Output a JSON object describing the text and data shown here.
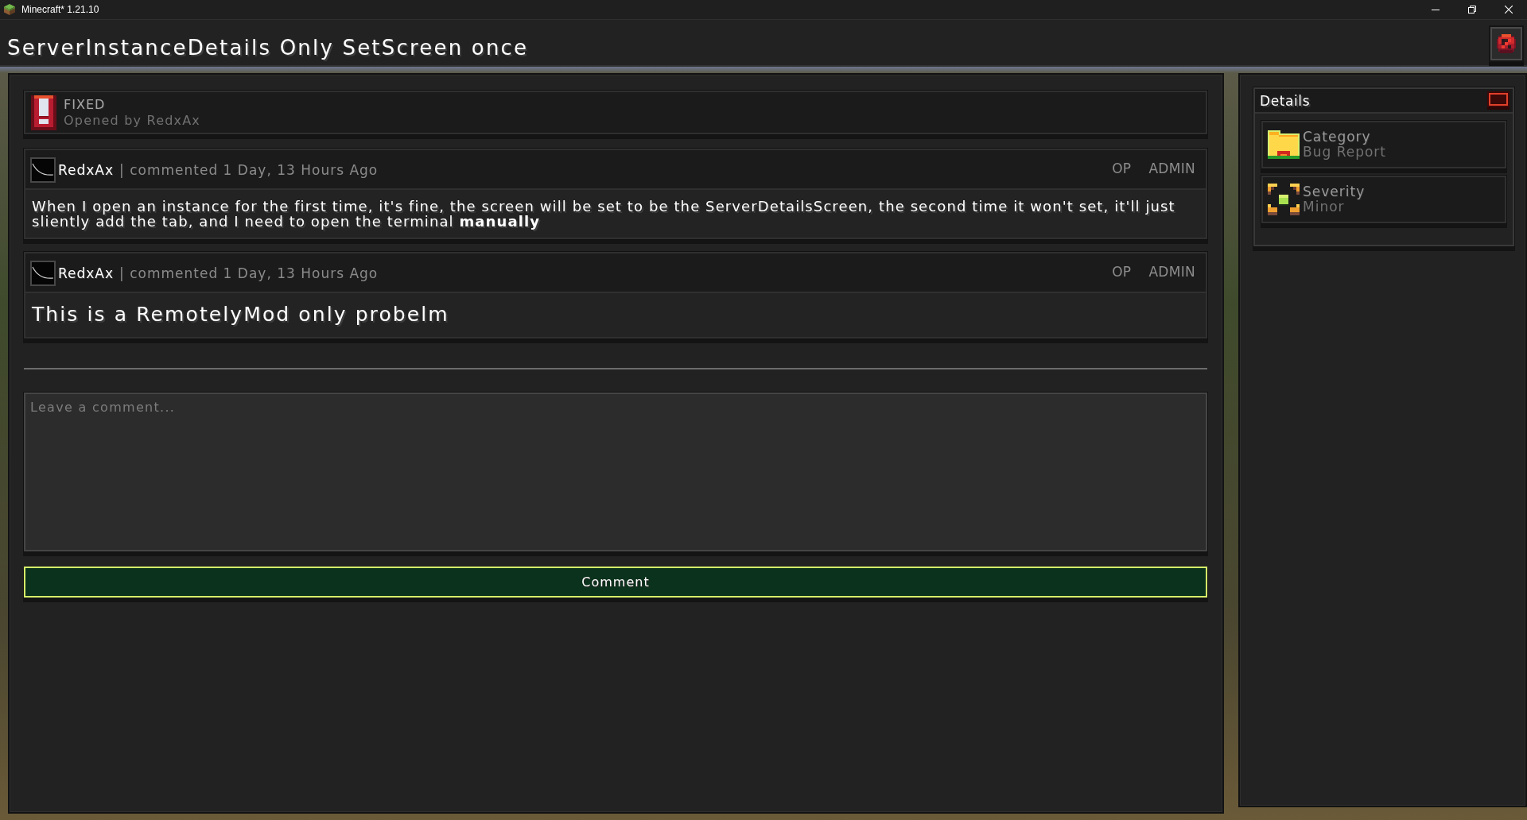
{
  "window": {
    "title": "Minecraft* 1.21.10"
  },
  "header": {
    "title": "ServerInstanceDetails Only SetScreen once"
  },
  "issue": {
    "status": "FIXED",
    "opened_by": "Opened by RedxAx"
  },
  "comments": [
    {
      "author": "RedxAx",
      "meta": "| commented 1 Day, 13 Hours Ago",
      "badges": [
        "OP",
        "ADMIN"
      ],
      "kind": "paragraph",
      "body": "When I open an instance for the first time, it's fine, the screen will be set to be the ServerDetailsScreen, the second time it won't set, it'll just sliently add the tab, and I need to open the terminal **manually**"
    },
    {
      "author": "RedxAx",
      "meta": "| commented 1 Day, 13 Hours Ago",
      "badges": [
        "OP",
        "ADMIN"
      ],
      "kind": "heading",
      "body": "This is a RemotelyMod only probelm"
    }
  ],
  "comment_box": {
    "placeholder": "Leave a comment..."
  },
  "submit_button": {
    "label": "Comment"
  },
  "details": {
    "title": "Details",
    "items": [
      {
        "kind": "category",
        "label": "Category",
        "value": "Bug Report"
      },
      {
        "kind": "severity",
        "label": "Severity",
        "value": "Minor"
      }
    ]
  }
}
